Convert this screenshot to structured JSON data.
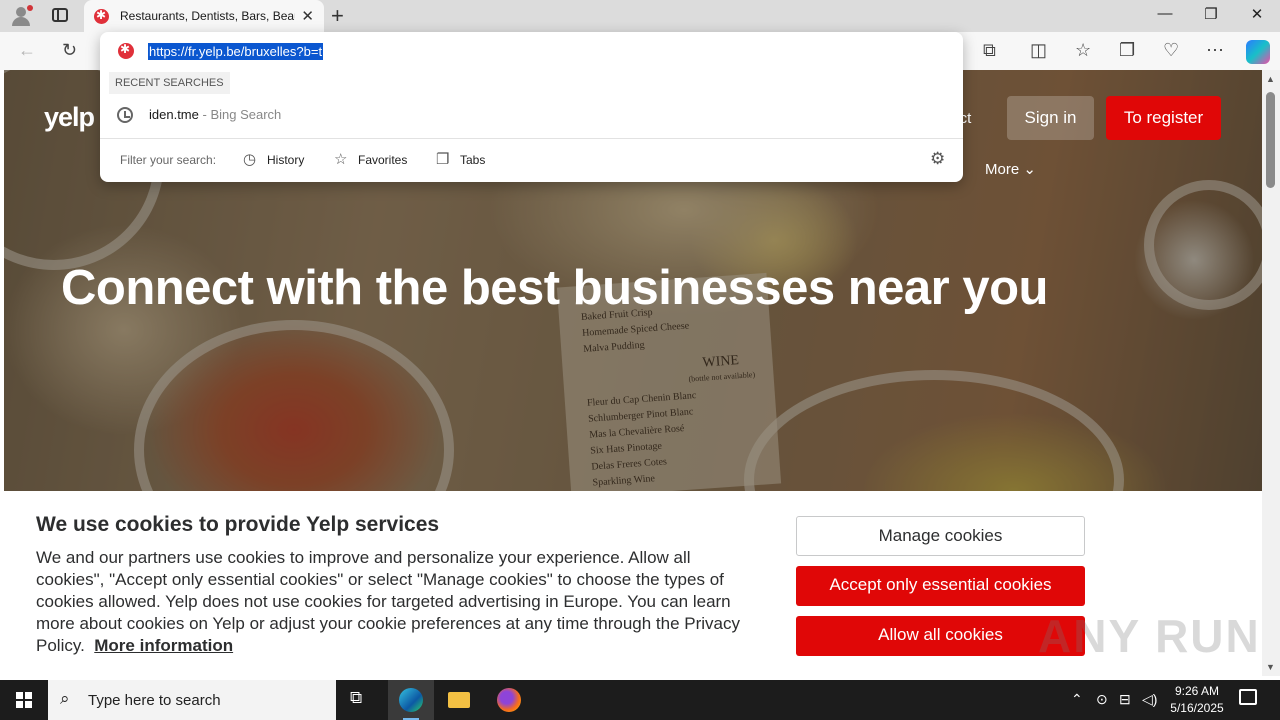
{
  "browser": {
    "tab_title": "Restaurants, Dentists, Bars, Beauty Salons",
    "tab_close": "✕",
    "new_tab": "+",
    "window_controls": {
      "minimize": "—",
      "maximize": "❐",
      "close": "✕"
    },
    "toolbar_icons": [
      "back-icon",
      "refresh-icon",
      "extensions-icon",
      "split-screen-icon",
      "favorites-icon",
      "collections-icon",
      "performance-icon",
      "more-icon",
      "copilot-icon"
    ]
  },
  "address_dropdown": {
    "url": "https://fr.yelp.be/bruxelles?b=t",
    "section_label": "RECENT SEARCHES",
    "recent": [
      {
        "query": "iden.tme",
        "separator": " - ",
        "source": "Bing Search"
      }
    ],
    "filter_label": "Filter your search:",
    "filters": [
      "History",
      "Favorites",
      "Tabs"
    ]
  },
  "yelp": {
    "logo": "yelp",
    "nav_partial": "ject",
    "sign_in": "Sign in",
    "register": "To register",
    "more": "More",
    "more_chevron": "⌄",
    "headline": "Connect with the best businesses near you",
    "colors": {
      "brand_red": "#e00707"
    }
  },
  "hero_menu": [
    "Baked Fruit Crisp",
    "Homemade Spiced Cheese",
    "Malva Pudding",
    "WINE",
    "(bottle not available)",
    "Fleur du Cap Chenin Blanc",
    "Schlumberger Pinot Blanc",
    "Mas la Chevalière Rosé",
    "Six Hats Pinotage",
    "Delas Freres Cotes",
    "Sparkling Wine"
  ],
  "cookie_banner": {
    "title": "We use cookies to provide Yelp services",
    "text": "We and our partners use cookies to improve and personalize your experience. Allow all cookies\", \"Accept only essential cookies\" or select \"Manage cookies\" to choose the types of cookies allowed. Yelp does not use cookies for targeted advertising in Europe. You can learn more about cookies on Yelp or adjust your cookie preferences at any time through the Privacy Policy.",
    "more_info": "More information",
    "manage": "Manage cookies",
    "essential": "Accept only essential cookies",
    "allow_all": "Allow all cookies"
  },
  "watermark": "ANY RUN",
  "taskbar": {
    "search_placeholder": "Type here to search",
    "time": "9:26 AM",
    "date": "5/16/2025"
  }
}
